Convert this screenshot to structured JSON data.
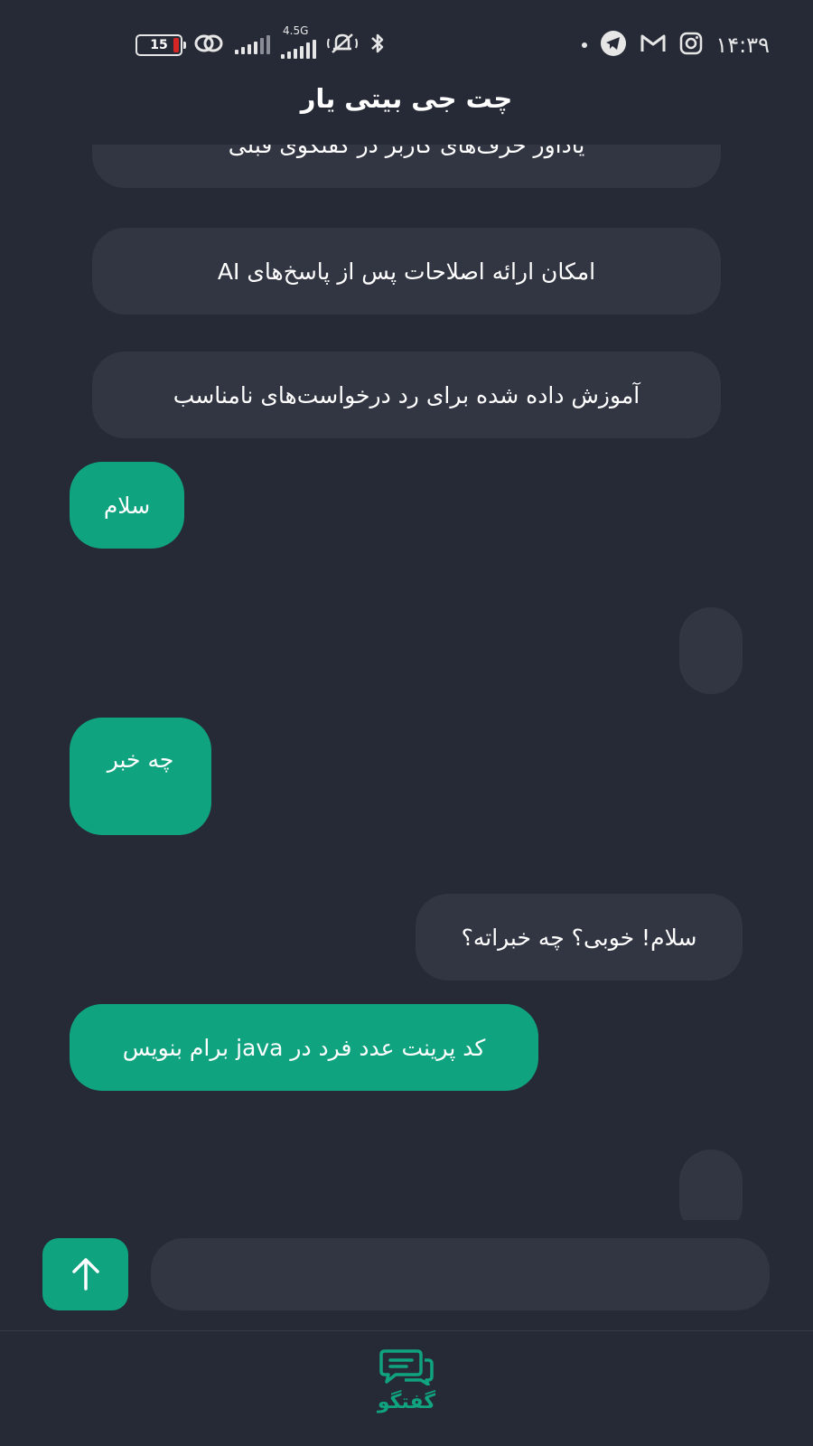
{
  "status_bar": {
    "battery_level": "15",
    "network_type": "4.5G",
    "time": "۱۴:۳۹"
  },
  "header": {
    "title": "چت جی بیتی یار"
  },
  "suggestions": [
    "یادآور حرف‌های کاربر در گفتگوی قبلی",
    "امکان ارائه اصلاحات پس از پاسخ‌های AI",
    "آموزش داده شده برای رد درخواست‌های نامناسب"
  ],
  "messages": {
    "user_1": "سلام",
    "user_2": "چه خبر",
    "bot_2": "سلام! خوبی؟ چه خبراته؟",
    "user_3": "کد پرینت عدد فرد در java برام بنویس"
  },
  "input": {
    "placeholder": ""
  },
  "bottom_nav": {
    "chat_label": "گفتگو"
  },
  "colors": {
    "accent": "#10a37f",
    "background": "#262a36",
    "bubble": "#323542"
  }
}
